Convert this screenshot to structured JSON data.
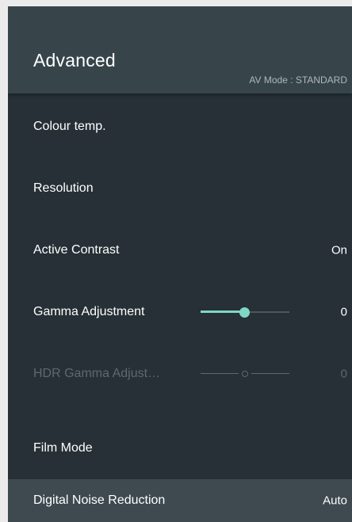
{
  "header": {
    "title": "Advanced",
    "subtitle": "AV Mode : STANDARD"
  },
  "rows": [
    {
      "label": "Colour temp.",
      "value": ""
    },
    {
      "label": "Resolution",
      "value": ""
    },
    {
      "label": "Active Contrast",
      "value": "On"
    },
    {
      "label": "Gamma Adjustment",
      "value": "0",
      "slider_position": 0.5
    },
    {
      "label": "HDR Gamma Adjust…",
      "value": "0",
      "slider_position": 0.5,
      "disabled": true
    },
    {
      "label": "Film Mode",
      "value": ""
    },
    {
      "label": "Digital Noise Reduction",
      "value": "Auto",
      "focused": true
    }
  ],
  "colors": {
    "accent": "#7fd7c7",
    "panel_background": "#263036",
    "header_background": "#37454b",
    "focused_row": "#3e4a50",
    "disabled_text": "#5e686d"
  }
}
